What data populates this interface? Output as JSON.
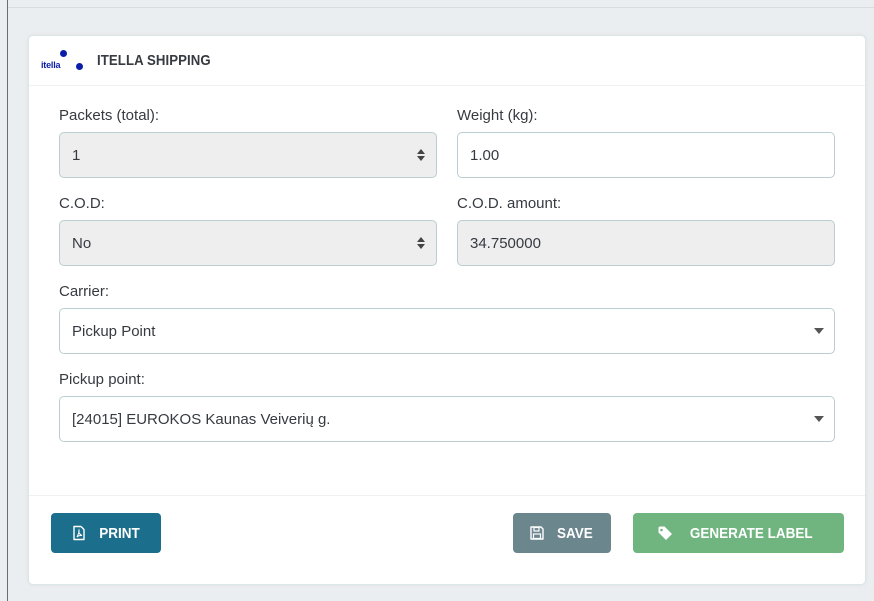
{
  "panel": {
    "logo_text": "itella",
    "title": "ITELLA SHIPPING"
  },
  "fields": {
    "packets": {
      "label": "Packets (total):",
      "value": "1"
    },
    "weight": {
      "label": "Weight (kg):",
      "value": "1.00"
    },
    "cod": {
      "label": "C.O.D:",
      "value": "No"
    },
    "cod_amount": {
      "label": "C.O.D. amount:",
      "value": "34.750000"
    },
    "carrier": {
      "label": "Carrier:",
      "value": "Pickup Point"
    },
    "pickup_point": {
      "label": "Pickup point:",
      "value": "[24015] EUROKOS Kaunas Veiverių g."
    }
  },
  "actions": {
    "print": {
      "label": "PRINT",
      "icon": "pdf-file-icon"
    },
    "save": {
      "label": "SAVE",
      "icon": "floppy-disk-icon"
    },
    "generate": {
      "label": "GENERATE LABEL",
      "icon": "tag-icon"
    }
  },
  "colors": {
    "print": "#1b6f8c",
    "save": "#6c868e",
    "generate": "#70b580",
    "brand": "#0b1ea8"
  }
}
